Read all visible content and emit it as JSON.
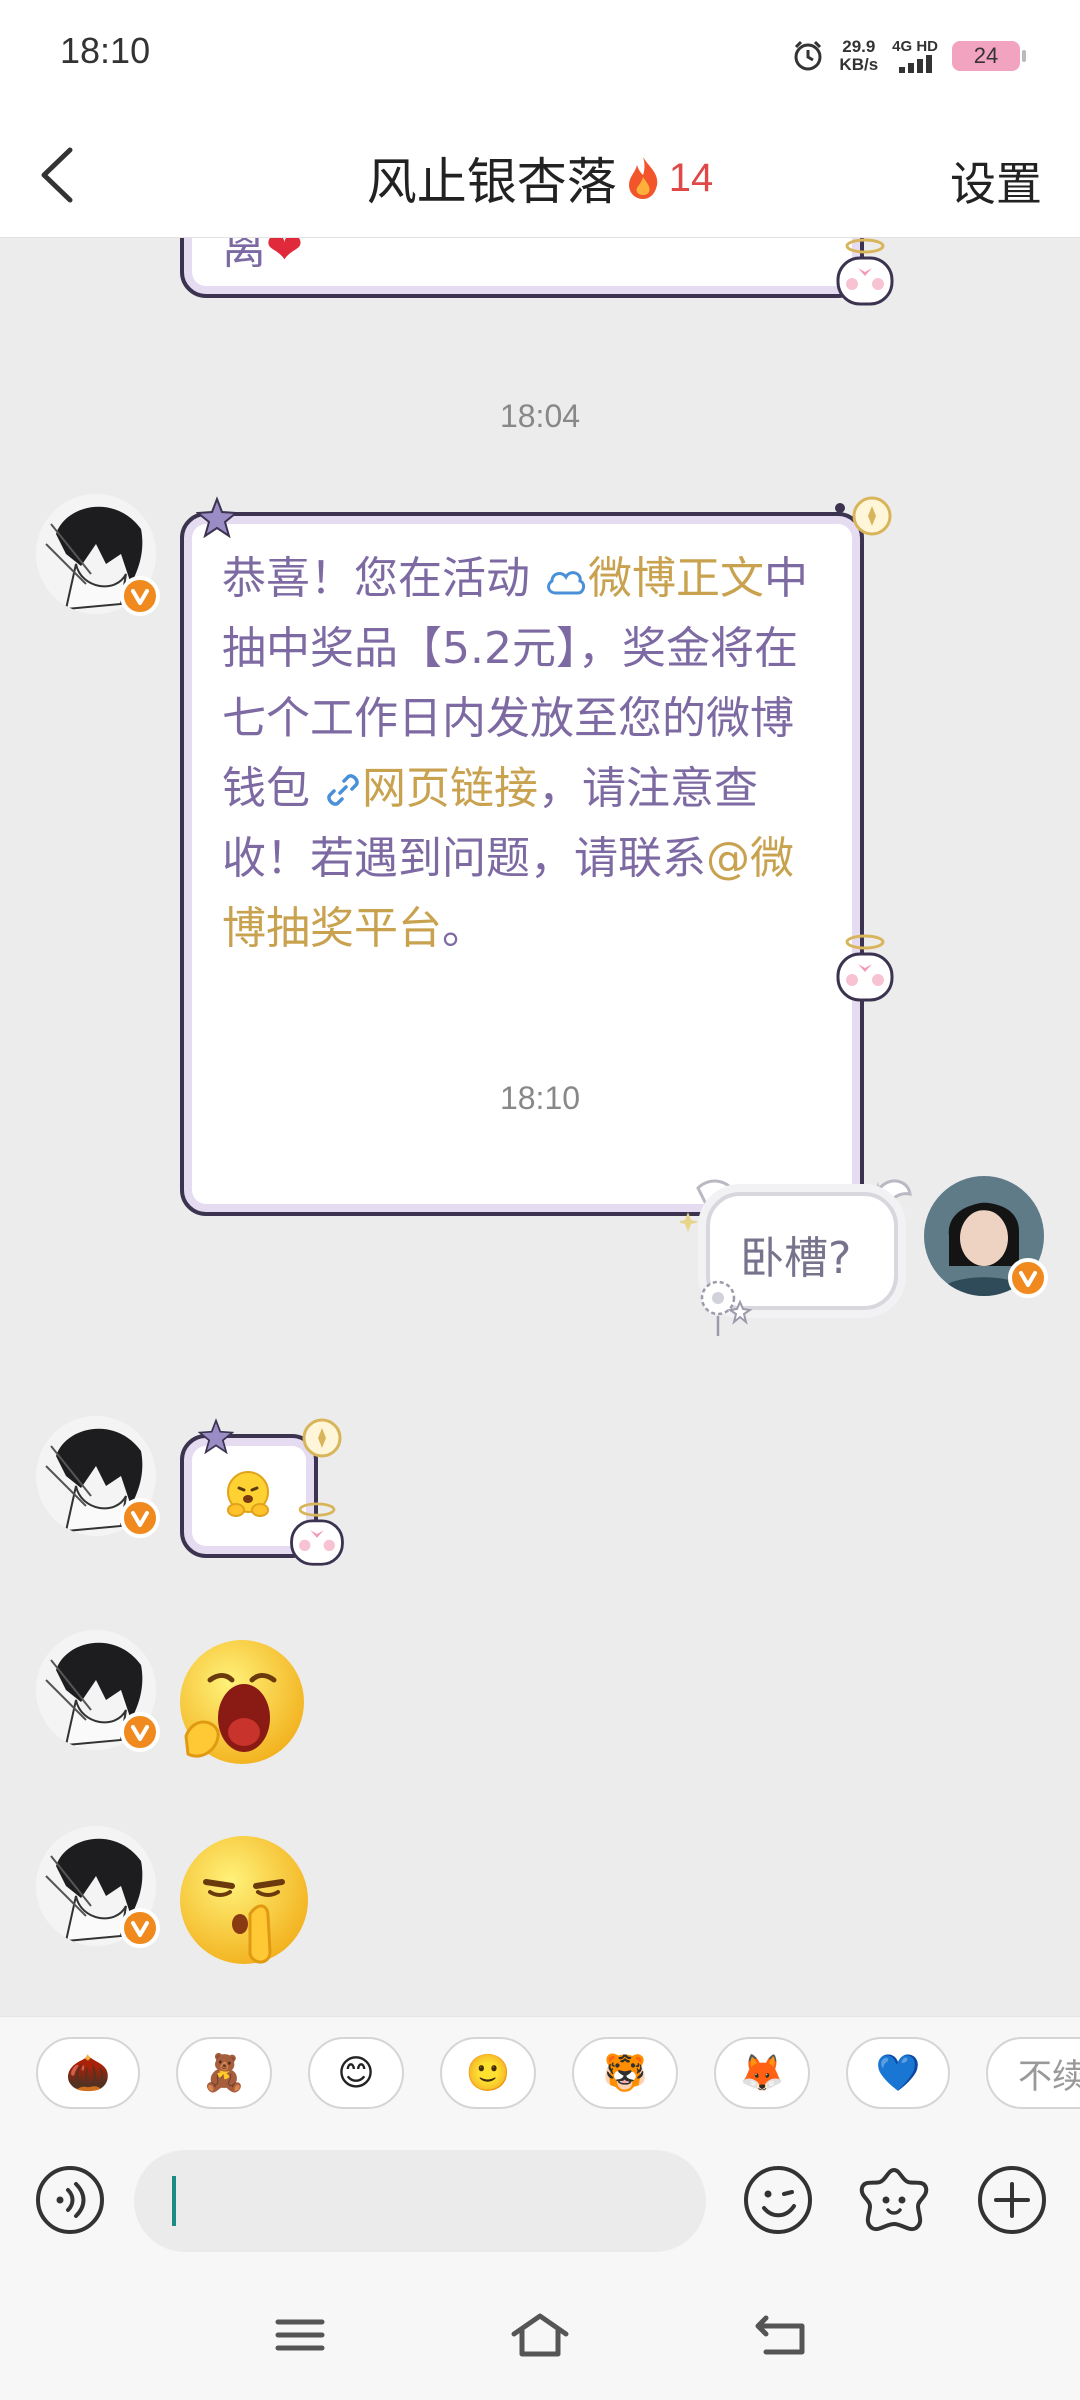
{
  "status_bar": {
    "time": "18:10",
    "net_speed_value": "29.9",
    "net_speed_unit": "KB/s",
    "signal_label": "4G HD",
    "battery": "24"
  },
  "header": {
    "title": "风止银杏落",
    "streak_count": "14",
    "settings_label": "设置"
  },
  "chat": {
    "partial_message_text": "离",
    "timestamps": [
      "18:04",
      "18:10"
    ],
    "lottery_message": {
      "part1": "恭喜！您在活动 ",
      "link_weibo": "微博正文",
      "part2": "中抽中奖品【5.2元】，奖金将在七个工作日内发放至您的微博钱包 ",
      "link_web": "网页链接",
      "part3": "，请注意查收！若遇到问题，请联系",
      "mention": "@微博抽奖平台",
      "part4": "。"
    },
    "my_message": "卧槽?"
  },
  "quick_reactions": {
    "items": [
      "🌰",
      "🧸",
      "😊",
      "🙂",
      "🐯",
      "🦊",
      "💙"
    ],
    "more_text": "不续"
  },
  "input": {
    "placeholder": ""
  },
  "colors": {
    "bubble_text": "#7d6aa3",
    "link_gold": "#c9a250",
    "verified_orange": "#f08a1e",
    "streak_red": "#e04848"
  }
}
